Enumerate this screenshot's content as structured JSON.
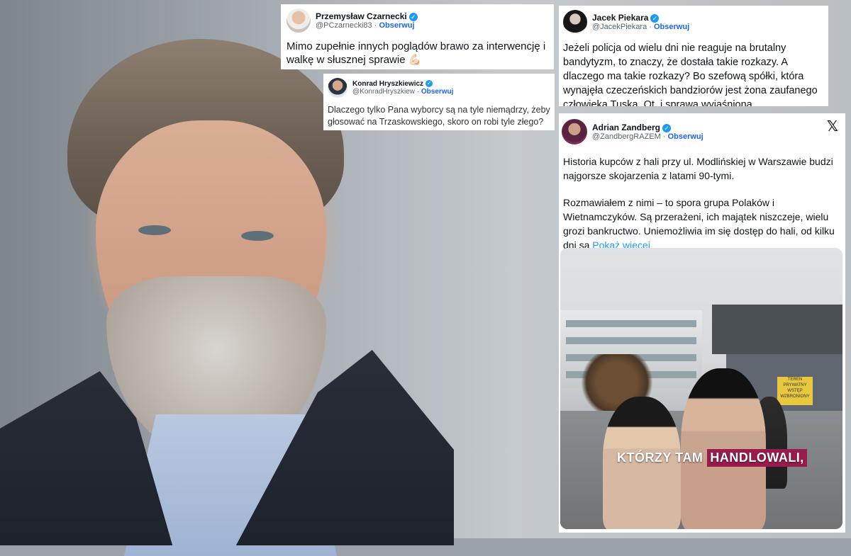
{
  "tweets": [
    {
      "name": "Przemysław Czarnecki",
      "handle": "@PCzarnecki83",
      "follow": "Obserwuj",
      "text": "Mimo zupełnie innych poglądów brawo za interwencję i walkę w słusznej sprawie 💪🏻"
    },
    {
      "name": "Konrad Hryszkiewicz",
      "handle": "@KonradHryszkiew",
      "follow": "Obserwuj",
      "text": "Dlaczego tylko Pana wyborcy są na tyle niemądrzy, żeby głosować na Trzaskowskiego, skoro on robi tyle złego?"
    },
    {
      "name": "Jacek Piekara",
      "handle": "@JacekPiekara",
      "follow": "Obserwuj",
      "text": "Jeżeli policja od wielu dni nie reaguje na brutalny bandytyzm, to znaczy, że dostała takie rozkazy. A dlaczego ma takie rozkazy? Bo szefową spółki, która wynajęła czeczeńskich bandziorów jest żona zaufanego człowieka Tuska. Ot, i sprawa wyjaśniona..."
    },
    {
      "name": "Adrian Zandberg",
      "handle": "@ZandbergRAZEM",
      "follow": "Obserwuj",
      "paragraph1": "Historia kupców z hali przy ul. Modlińskiej w Warszawie budzi najgorsze skojarzenia z latami 90-tymi.",
      "paragraph2": "Rozmawiałem z nimi – to spora grupa Polaków i Wietnamczyków. Są przerażeni, ich majątek niszczeje, wielu grozi bankructwo. Uniemożliwia im się dostęp do hali, od kilku dni są",
      "show_more": "Pokaż więcej",
      "video_caption_plain": "KTÓRZY TAM",
      "video_caption_highlight": "HANDLOWALI,",
      "sign_text": "TEREN PRYWATNY WSTĘP WZBRONIONY"
    }
  ],
  "icons": {
    "verified": "verified-badge-icon",
    "x_logo": "x-logo-icon"
  },
  "colors": {
    "verified": "#1d9bf0",
    "follow": "#1d64f0",
    "caption_highlight": "#9b1b4f"
  }
}
